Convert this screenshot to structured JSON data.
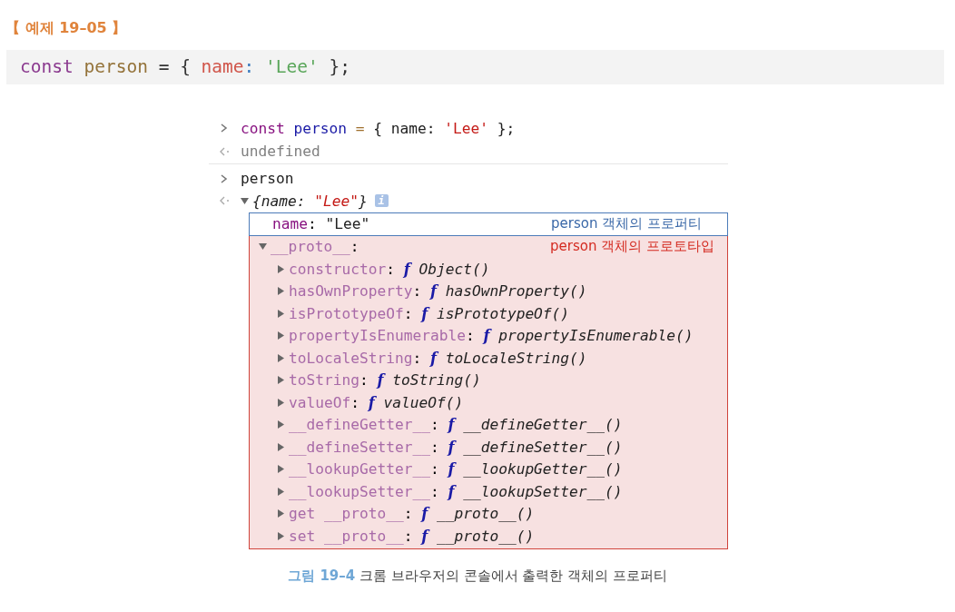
{
  "example_label": "【 예제 19–05 】",
  "code_block": {
    "tokens": [
      {
        "text": "const ",
        "kind": "keyword"
      },
      {
        "text": "person",
        "kind": "variable"
      },
      {
        "text": " = { ",
        "kind": "plain"
      },
      {
        "text": "name",
        "kind": "property"
      },
      {
        "text": ": ",
        "kind": "punct"
      },
      {
        "text": "'Lee'",
        "kind": "string"
      },
      {
        "text": " };",
        "kind": "plain"
      }
    ]
  },
  "console": {
    "entries": [
      {
        "kind": "input",
        "divider_after": false,
        "tokens": [
          {
            "text": "const ",
            "kind": "keyword"
          },
          {
            "text": "person ",
            "kind": "variable"
          },
          {
            "text": "=",
            "kind": "operator"
          },
          {
            "text": " { name: ",
            "kind": "plain"
          },
          {
            "text": "'Lee'",
            "kind": "string"
          },
          {
            "text": " };",
            "kind": "plain"
          }
        ]
      },
      {
        "kind": "output",
        "divider_after": true,
        "tokens": [
          {
            "text": "undefined",
            "kind": "muted"
          }
        ]
      },
      {
        "kind": "input",
        "divider_after": false,
        "tokens": [
          {
            "text": "person",
            "kind": "plain"
          }
        ]
      }
    ],
    "object_output": {
      "expanded": true,
      "preview_tokens": [
        {
          "text": "{name: ",
          "kind": "italic"
        },
        {
          "text": "\"Lee\"",
          "kind": "italic-string"
        },
        {
          "text": "}",
          "kind": "italic"
        }
      ],
      "info_badge": "i",
      "own_property": {
        "key": "name",
        "separator": ":",
        "value": "\"Lee\"",
        "annotation": "person 객체의 프로퍼티"
      },
      "prototype": {
        "key": "__proto__",
        "separator": ":",
        "expanded": true,
        "annotation": "person 객체의 프로토타입",
        "children": [
          {
            "key": "constructor",
            "marker": "f",
            "value": "Object()",
            "expanded": false
          },
          {
            "key": "hasOwnProperty",
            "marker": "f",
            "value": "hasOwnProperty()",
            "expanded": false
          },
          {
            "key": "isPrototypeOf",
            "marker": "f",
            "value": "isPrototypeOf()",
            "expanded": false
          },
          {
            "key": "propertyIsEnumerable",
            "marker": "f",
            "value": "propertyIsEnumerable()",
            "expanded": false
          },
          {
            "key": "toLocaleString",
            "marker": "f",
            "value": "toLocaleString()",
            "expanded": false
          },
          {
            "key": "toString",
            "marker": "f",
            "value": "toString()",
            "expanded": false
          },
          {
            "key": "valueOf",
            "marker": "f",
            "value": "valueOf()",
            "expanded": false
          },
          {
            "key": "__defineGetter__",
            "marker": "f",
            "value": "__defineGetter__()",
            "expanded": false
          },
          {
            "key": "__defineSetter__",
            "marker": "f",
            "value": "__defineSetter__()",
            "expanded": false
          },
          {
            "key": "__lookupGetter__",
            "marker": "f",
            "value": "__lookupGetter__()",
            "expanded": false
          },
          {
            "key": "__lookupSetter__",
            "marker": "f",
            "value": "__lookupSetter__()",
            "expanded": false
          },
          {
            "key": "get __proto__",
            "marker": "f",
            "value": "__proto__()",
            "expanded": false
          },
          {
            "key": "set __proto__",
            "marker": "f",
            "value": "__proto__()",
            "expanded": false
          }
        ]
      }
    }
  },
  "caption": {
    "label": "그림 19–4",
    "text": "크롬 브라우저의 콘솔에서 출력한 객체의 프로퍼티"
  }
}
